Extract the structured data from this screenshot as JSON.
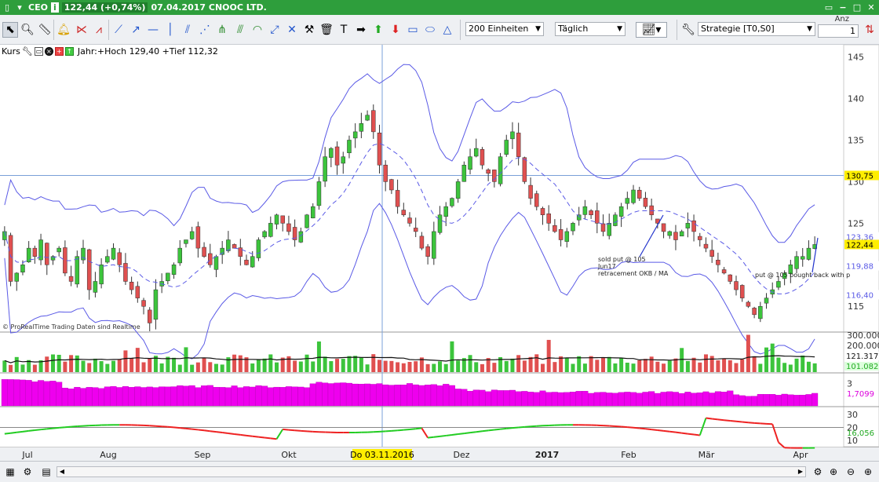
{
  "titlebar": {
    "ticker": "CEO",
    "price_change": "122,44 (+0,74%)",
    "date_name": "07.04.2017 CNOOC LTD."
  },
  "toolbar": {
    "units_select": "200 Einheiten",
    "period_select": "Täglich",
    "strategy_select": "Strategie [T0,S0]",
    "anz_label": "Anz",
    "anz_value": "1"
  },
  "chart": {
    "kurs_label": "Kurs",
    "year_info": "Jahr:+Hoch 129,40 +Tief 112,32",
    "copyright": "© ProRealTime Trading Daten sind Realtime",
    "annotation_1": [
      "sold put @ 105",
      "Jun17",
      "retracement OKB / MA"
    ],
    "annotation_2": "put @ 105 bought back with p",
    "crosshair_date": "Do 03.11.2016",
    "price_axis": [
      "145",
      "140",
      "135",
      "130",
      "125",
      "120",
      "115"
    ],
    "price_tags": {
      "crosshair": "130,75",
      "upper_band": "123,36",
      "last": "122,44",
      "mid_band": "119,88",
      "lower_band": "116,40"
    },
    "volume_axis": [
      "300.000",
      "200.000"
    ],
    "volume_tags": {
      "ma": "121.317",
      "last": "101.082"
    },
    "ind1_axis": [
      "3"
    ],
    "ind1_tag": "1,7099",
    "ind2_axis": [
      "30",
      "20",
      "10"
    ],
    "ind2_tag": "16,056",
    "x_labels": [
      "Jul",
      "Aug",
      "Sep",
      "Okt",
      "Dez",
      "2017",
      "Feb",
      "Mär",
      "Apr"
    ]
  },
  "colors": {
    "title_green": "#2e9e3c",
    "up_candle": "#3cc43c",
    "down_candle": "#e05050",
    "band": "#5a5ae6",
    "magenta": "#ee00ee",
    "price_tag_bg": "#ffee00"
  },
  "chart_data": {
    "type": "candlestick",
    "title": "CEO 07.04.2017 CNOOC LTD.",
    "ylim": [
      112,
      146
    ],
    "last_close": 122.44,
    "year_high": 129.4,
    "year_low": 112.32,
    "closes": [
      124,
      118,
      119,
      120,
      122,
      121,
      123,
      120,
      121,
      122,
      119,
      118,
      121,
      122,
      117,
      118,
      120,
      121,
      122,
      120,
      118,
      117,
      116,
      115,
      113,
      117,
      118,
      119,
      120,
      122,
      123,
      124,
      122,
      121,
      120,
      121,
      122,
      123,
      122,
      121,
      120,
      121,
      123,
      124,
      125,
      126,
      125,
      124,
      123,
      124,
      126,
      127,
      130,
      133,
      134,
      132,
      133,
      135,
      136,
      137,
      138,
      136,
      132,
      130,
      129,
      127,
      126,
      125,
      124,
      122,
      121,
      124,
      126,
      127,
      128,
      130,
      132,
      133,
      134,
      132,
      131,
      130,
      133,
      135,
      136,
      133,
      130,
      128,
      127,
      126,
      125,
      124,
      123,
      124,
      125,
      126,
      127,
      126,
      125,
      124,
      125,
      126,
      127,
      128,
      129,
      128,
      127,
      126,
      125,
      124,
      124,
      123,
      124,
      125,
      124,
      123,
      122,
      121,
      120,
      119,
      118,
      117,
      116,
      115,
      114,
      115,
      116,
      117,
      118,
      119,
      120,
      121,
      121,
      122,
      122.44
    ]
  }
}
